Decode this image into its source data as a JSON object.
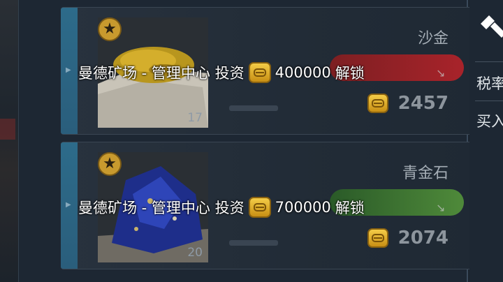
{
  "items": [
    {
      "name": "沙金",
      "count": "17",
      "price": "2457",
      "unlock": {
        "prefix": "曼德矿场 - 管理中心 投资",
        "amount": "400000",
        "suffix": "解锁"
      },
      "pill_color": "#a8232a"
    },
    {
      "name": "青金石",
      "count": "20",
      "price": "2074",
      "unlock": {
        "prefix": "曼德矿场 - 管理中心 投资",
        "amount": "700000",
        "suffix": "解锁"
      },
      "pill_color": "#4f8a3a"
    }
  ],
  "side": {
    "tax_label": "税率",
    "buy_label": "买入"
  },
  "icons": {
    "badge": "star-badge-icon",
    "currency": "coin-icon",
    "trend": "trend-arrow-icon",
    "side": "hammer-icon"
  },
  "colors": {
    "strip": "#2d6b8a",
    "coin": "#f4cc47"
  }
}
